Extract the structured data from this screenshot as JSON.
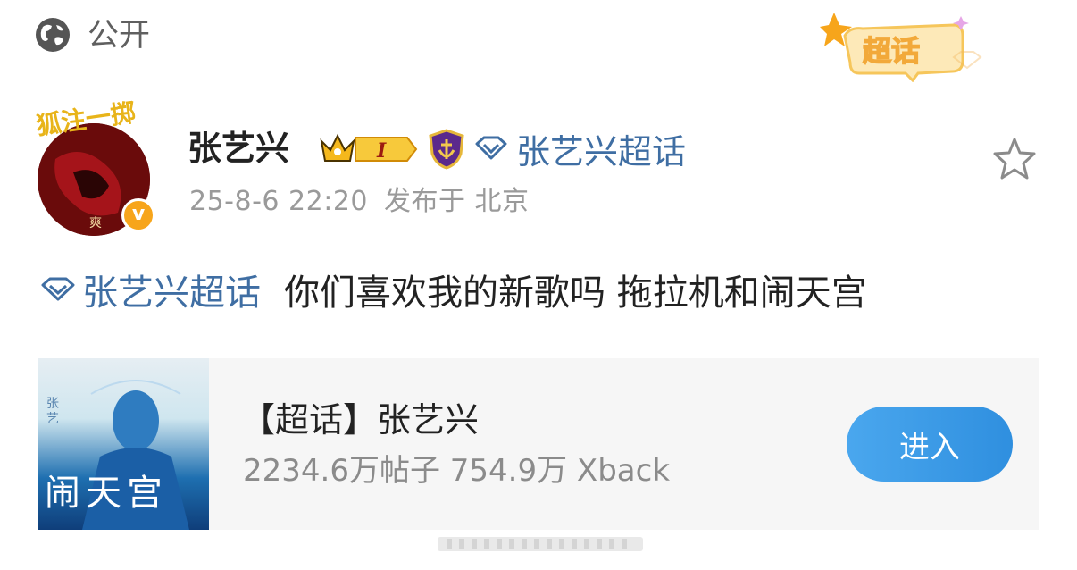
{
  "header": {
    "visibility_label": "公开",
    "icon": "globe-icon",
    "sticker_label": "超话"
  },
  "post": {
    "author": "张艺兴",
    "level_badge": "I",
    "supertopic_name": "张艺兴超话",
    "timestamp": "25-8-6 22:20",
    "location": "发布于 北京",
    "avatar_text": "狐注一掷",
    "verified_badge": "v",
    "body_topic": "张艺兴超话",
    "body_text": "你们喜欢我的新歌吗 拖拉机和闹天宫"
  },
  "card": {
    "title": "【超话】张艺兴",
    "stats": "2234.6万帖子 754.9万 Xback",
    "cover_title": "闹天宫",
    "enter_label": "进入"
  },
  "colors": {
    "link_blue": "#3f6ea3",
    "button_blue": "#3a9be8",
    "gold": "#f7a51b"
  }
}
